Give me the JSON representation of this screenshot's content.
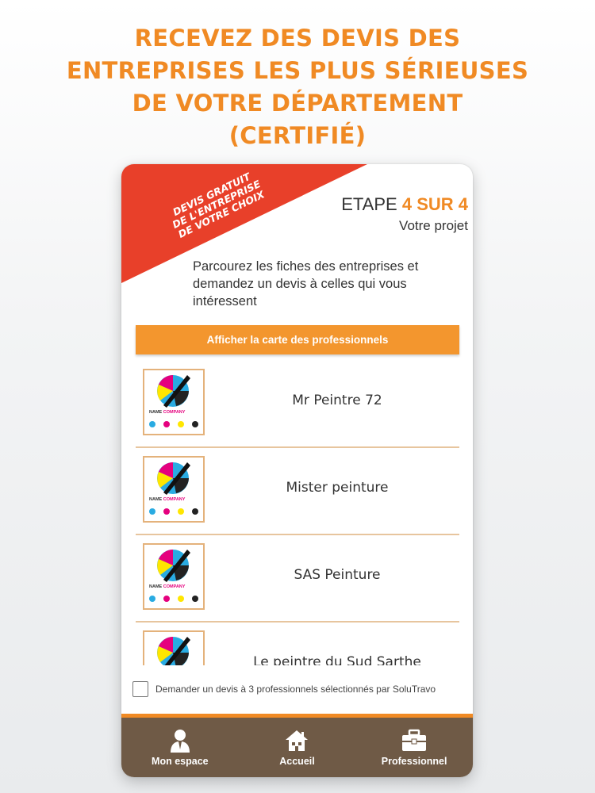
{
  "headline": {
    "lines": [
      "RECEVEZ DES DEVIS DES",
      "ENTREPRISES LES PLUS SÉRIEUSES",
      "DE VOTRE DÉPARTEMENT",
      "(CERTIFIÉ)"
    ]
  },
  "ribbon": {
    "lines": [
      "DEVIS GRATUIT",
      "DE L'ENTREPRISE",
      "DE VOTRE CHOIX"
    ]
  },
  "step": {
    "word": "ETAPE",
    "number": "4 SUR 4",
    "subtitle": "Votre projet"
  },
  "intro": {
    "text": "Parcourez les fiches des entreprises et demandez un devis à celles qui vous intéressent"
  },
  "map_button": {
    "label": "Afficher la carte des professionnels"
  },
  "logo_text": {
    "name": "NAME",
    "company": "COMPANY"
  },
  "companies": [
    {
      "name": "Mr Peintre 72"
    },
    {
      "name": "Mister peinture"
    },
    {
      "name": "SAS Peinture"
    },
    {
      "name": "Le peintre du Sud Sarthe"
    }
  ],
  "checkbox": {
    "label": "Demander un devis à 3 professionnels sélectionnés par SoluTravo",
    "checked": false
  },
  "nav": {
    "items": [
      {
        "label": "Mon espace",
        "icon": "user-icon"
      },
      {
        "label": "Accueil",
        "icon": "home-icon"
      },
      {
        "label": "Professionnel",
        "icon": "briefcase-icon"
      }
    ]
  },
  "colors": {
    "accent": "#f08a24",
    "ribbon": "#e8402a",
    "nav_bg": "#6f5a46",
    "logo_cyan": "#29abe2",
    "logo_magenta": "#e5007e",
    "logo_yellow": "#ffe600",
    "logo_black": "#222222"
  }
}
